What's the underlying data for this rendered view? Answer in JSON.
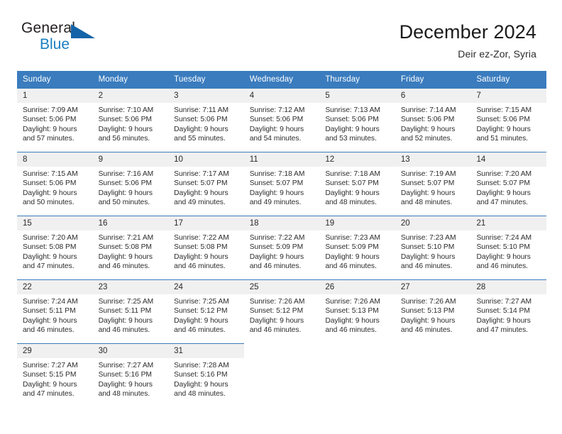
{
  "brand": {
    "name_part1": "General",
    "name_part2": "Blue",
    "triangle_color": "#1463a8"
  },
  "header": {
    "title": "December 2024",
    "subtitle": "Deir ez-Zor, Syria",
    "accent_color": "#3a7cbe"
  },
  "weekdays": [
    "Sunday",
    "Monday",
    "Tuesday",
    "Wednesday",
    "Thursday",
    "Friday",
    "Saturday"
  ],
  "weeks": [
    [
      {
        "day": "1",
        "l1": "Sunrise: 7:09 AM",
        "l2": "Sunset: 5:06 PM",
        "l3": "Daylight: 9 hours",
        "l4": "and 57 minutes."
      },
      {
        "day": "2",
        "l1": "Sunrise: 7:10 AM",
        "l2": "Sunset: 5:06 PM",
        "l3": "Daylight: 9 hours",
        "l4": "and 56 minutes."
      },
      {
        "day": "3",
        "l1": "Sunrise: 7:11 AM",
        "l2": "Sunset: 5:06 PM",
        "l3": "Daylight: 9 hours",
        "l4": "and 55 minutes."
      },
      {
        "day": "4",
        "l1": "Sunrise: 7:12 AM",
        "l2": "Sunset: 5:06 PM",
        "l3": "Daylight: 9 hours",
        "l4": "and 54 minutes."
      },
      {
        "day": "5",
        "l1": "Sunrise: 7:13 AM",
        "l2": "Sunset: 5:06 PM",
        "l3": "Daylight: 9 hours",
        "l4": "and 53 minutes."
      },
      {
        "day": "6",
        "l1": "Sunrise: 7:14 AM",
        "l2": "Sunset: 5:06 PM",
        "l3": "Daylight: 9 hours",
        "l4": "and 52 minutes."
      },
      {
        "day": "7",
        "l1": "Sunrise: 7:15 AM",
        "l2": "Sunset: 5:06 PM",
        "l3": "Daylight: 9 hours",
        "l4": "and 51 minutes."
      }
    ],
    [
      {
        "day": "8",
        "l1": "Sunrise: 7:15 AM",
        "l2": "Sunset: 5:06 PM",
        "l3": "Daylight: 9 hours",
        "l4": "and 50 minutes."
      },
      {
        "day": "9",
        "l1": "Sunrise: 7:16 AM",
        "l2": "Sunset: 5:06 PM",
        "l3": "Daylight: 9 hours",
        "l4": "and 50 minutes."
      },
      {
        "day": "10",
        "l1": "Sunrise: 7:17 AM",
        "l2": "Sunset: 5:07 PM",
        "l3": "Daylight: 9 hours",
        "l4": "and 49 minutes."
      },
      {
        "day": "11",
        "l1": "Sunrise: 7:18 AM",
        "l2": "Sunset: 5:07 PM",
        "l3": "Daylight: 9 hours",
        "l4": "and 49 minutes."
      },
      {
        "day": "12",
        "l1": "Sunrise: 7:18 AM",
        "l2": "Sunset: 5:07 PM",
        "l3": "Daylight: 9 hours",
        "l4": "and 48 minutes."
      },
      {
        "day": "13",
        "l1": "Sunrise: 7:19 AM",
        "l2": "Sunset: 5:07 PM",
        "l3": "Daylight: 9 hours",
        "l4": "and 48 minutes."
      },
      {
        "day": "14",
        "l1": "Sunrise: 7:20 AM",
        "l2": "Sunset: 5:07 PM",
        "l3": "Daylight: 9 hours",
        "l4": "and 47 minutes."
      }
    ],
    [
      {
        "day": "15",
        "l1": "Sunrise: 7:20 AM",
        "l2": "Sunset: 5:08 PM",
        "l3": "Daylight: 9 hours",
        "l4": "and 47 minutes."
      },
      {
        "day": "16",
        "l1": "Sunrise: 7:21 AM",
        "l2": "Sunset: 5:08 PM",
        "l3": "Daylight: 9 hours",
        "l4": "and 46 minutes."
      },
      {
        "day": "17",
        "l1": "Sunrise: 7:22 AM",
        "l2": "Sunset: 5:08 PM",
        "l3": "Daylight: 9 hours",
        "l4": "and 46 minutes."
      },
      {
        "day": "18",
        "l1": "Sunrise: 7:22 AM",
        "l2": "Sunset: 5:09 PM",
        "l3": "Daylight: 9 hours",
        "l4": "and 46 minutes."
      },
      {
        "day": "19",
        "l1": "Sunrise: 7:23 AM",
        "l2": "Sunset: 5:09 PM",
        "l3": "Daylight: 9 hours",
        "l4": "and 46 minutes."
      },
      {
        "day": "20",
        "l1": "Sunrise: 7:23 AM",
        "l2": "Sunset: 5:10 PM",
        "l3": "Daylight: 9 hours",
        "l4": "and 46 minutes."
      },
      {
        "day": "21",
        "l1": "Sunrise: 7:24 AM",
        "l2": "Sunset: 5:10 PM",
        "l3": "Daylight: 9 hours",
        "l4": "and 46 minutes."
      }
    ],
    [
      {
        "day": "22",
        "l1": "Sunrise: 7:24 AM",
        "l2": "Sunset: 5:11 PM",
        "l3": "Daylight: 9 hours",
        "l4": "and 46 minutes."
      },
      {
        "day": "23",
        "l1": "Sunrise: 7:25 AM",
        "l2": "Sunset: 5:11 PM",
        "l3": "Daylight: 9 hours",
        "l4": "and 46 minutes."
      },
      {
        "day": "24",
        "l1": "Sunrise: 7:25 AM",
        "l2": "Sunset: 5:12 PM",
        "l3": "Daylight: 9 hours",
        "l4": "and 46 minutes."
      },
      {
        "day": "25",
        "l1": "Sunrise: 7:26 AM",
        "l2": "Sunset: 5:12 PM",
        "l3": "Daylight: 9 hours",
        "l4": "and 46 minutes."
      },
      {
        "day": "26",
        "l1": "Sunrise: 7:26 AM",
        "l2": "Sunset: 5:13 PM",
        "l3": "Daylight: 9 hours",
        "l4": "and 46 minutes."
      },
      {
        "day": "27",
        "l1": "Sunrise: 7:26 AM",
        "l2": "Sunset: 5:13 PM",
        "l3": "Daylight: 9 hours",
        "l4": "and 46 minutes."
      },
      {
        "day": "28",
        "l1": "Sunrise: 7:27 AM",
        "l2": "Sunset: 5:14 PM",
        "l3": "Daylight: 9 hours",
        "l4": "and 47 minutes."
      }
    ],
    [
      {
        "day": "29",
        "l1": "Sunrise: 7:27 AM",
        "l2": "Sunset: 5:15 PM",
        "l3": "Daylight: 9 hours",
        "l4": "and 47 minutes."
      },
      {
        "day": "30",
        "l1": "Sunrise: 7:27 AM",
        "l2": "Sunset: 5:16 PM",
        "l3": "Daylight: 9 hours",
        "l4": "and 48 minutes."
      },
      {
        "day": "31",
        "l1": "Sunrise: 7:28 AM",
        "l2": "Sunset: 5:16 PM",
        "l3": "Daylight: 9 hours",
        "l4": "and 48 minutes."
      },
      null,
      null,
      null,
      null
    ]
  ]
}
